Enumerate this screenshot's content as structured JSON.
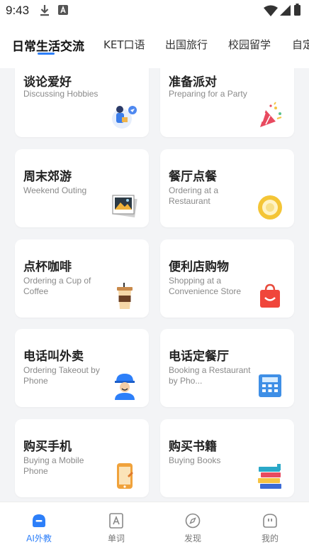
{
  "status": {
    "time": "9:43"
  },
  "tabs": [
    {
      "label": "日常生活交流",
      "active": true
    },
    {
      "label": "KET口语"
    },
    {
      "label": "出国旅行"
    },
    {
      "label": "校园留学"
    },
    {
      "label": "自定"
    }
  ],
  "cards": [
    {
      "title": "谈论爱好",
      "subtitle": "Discussing Hobbies",
      "icon": "hobbies-icon"
    },
    {
      "title": "准备派对",
      "subtitle": "Preparing for a Party",
      "icon": "party-popper-icon"
    },
    {
      "title": "周末郊游",
      "subtitle": "Weekend Outing",
      "icon": "photo-icon"
    },
    {
      "title": "餐厅点餐",
      "subtitle": "Ordering at a Restaurant",
      "icon": "plate-icon"
    },
    {
      "title": "点杯咖啡",
      "subtitle": "Ordering a Cup of Coffee",
      "icon": "coffee-cup-icon"
    },
    {
      "title": "便利店购物",
      "subtitle": "Shopping at a Convenience Store",
      "icon": "shopping-bag-icon"
    },
    {
      "title": "电话叫外卖",
      "subtitle": "Ordering Takeout by Phone",
      "icon": "delivery-person-icon"
    },
    {
      "title": "电话定餐厅",
      "subtitle": "Booking a Restaurant by Pho...",
      "icon": "telephone-icon"
    },
    {
      "title": "购买手机",
      "subtitle": "Buying a Mobile Phone",
      "icon": "mobile-phone-icon"
    },
    {
      "title": "购买书籍",
      "subtitle": "Buying Books",
      "icon": "books-icon"
    }
  ],
  "nav": [
    {
      "label": "AI外教",
      "icon": "ai-tutor-icon",
      "active": true
    },
    {
      "label": "单词",
      "icon": "vocabulary-icon"
    },
    {
      "label": "发现",
      "icon": "compass-icon"
    },
    {
      "label": "我的",
      "icon": "profile-icon"
    }
  ],
  "colors": {
    "accent": "#2d7ff9",
    "background": "#f3f4f6",
    "card": "#ffffff"
  }
}
